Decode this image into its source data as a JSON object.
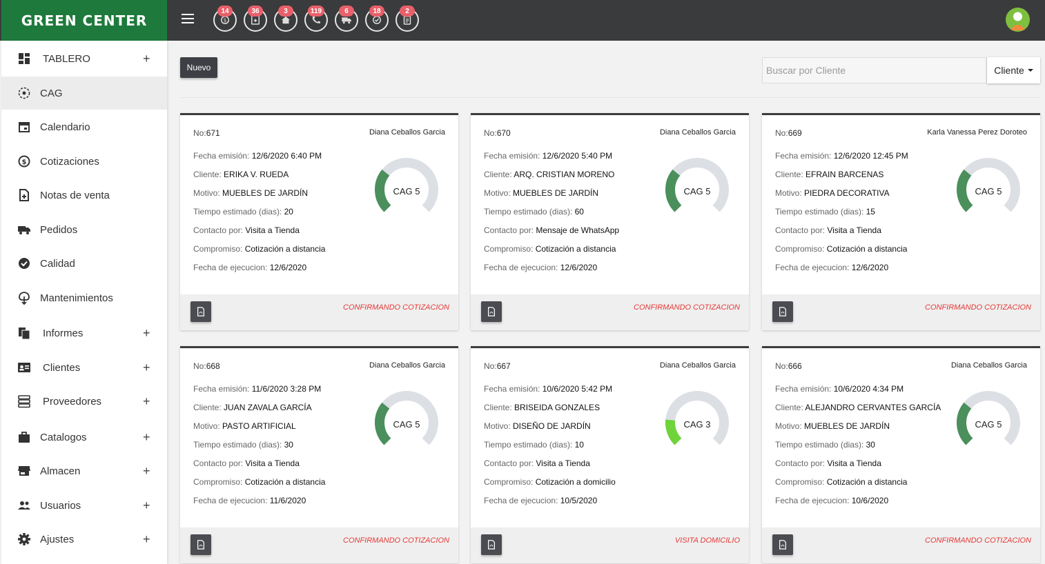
{
  "brand": "GREEN CENTER",
  "nav_icons": [
    {
      "icon": "money-icon",
      "badge": "14"
    },
    {
      "icon": "note-add-icon",
      "badge": "36"
    },
    {
      "icon": "home-icon",
      "badge": "3"
    },
    {
      "icon": "phone-icon",
      "badge": "119"
    },
    {
      "icon": "truck-icon",
      "badge": "6"
    },
    {
      "icon": "check-circle-icon",
      "badge": "18"
    },
    {
      "icon": "clipboard-icon",
      "badge": "2"
    }
  ],
  "sidebar": {
    "items": [
      {
        "label": "TABLERO",
        "icon": "dashboard-icon",
        "expandable": "+"
      },
      {
        "label": "CAG",
        "icon": "target-icon",
        "expandable": ""
      },
      {
        "label": "Calendario",
        "icon": "calendar-icon",
        "expandable": ""
      },
      {
        "label": "Cotizaciones",
        "icon": "dollar-circle-icon",
        "expandable": ""
      },
      {
        "label": "Notas de venta",
        "icon": "note-add-icon",
        "expandable": ""
      },
      {
        "label": "Pedidos",
        "icon": "truck-icon",
        "expandable": ""
      },
      {
        "label": "Calidad",
        "icon": "check-circle-icon",
        "expandable": ""
      },
      {
        "label": "Mantenimientos",
        "icon": "tree-icon",
        "expandable": ""
      },
      {
        "label": "Informes",
        "icon": "documents-icon",
        "expandable": "+"
      },
      {
        "label": "Clientes",
        "icon": "contact-card-icon",
        "expandable": "+"
      },
      {
        "label": "Proveedores",
        "icon": "list-icon",
        "expandable": "+"
      },
      {
        "label": "Catalogos",
        "icon": "briefcase-icon",
        "expandable": "+"
      },
      {
        "label": "Almacen",
        "icon": "store-icon",
        "expandable": "+"
      },
      {
        "label": "Usuarios",
        "icon": "users-icon",
        "expandable": "+"
      },
      {
        "label": "Ajustes",
        "icon": "gear-icon",
        "expandable": "+"
      }
    ],
    "active_index": 1
  },
  "toolbar": {
    "new_label": "Nuevo",
    "search_placeholder": "Buscar por Cliente",
    "filter_label": "Cliente"
  },
  "field_labels": {
    "no": "No:",
    "fecha_emision": "Fecha emisión: ",
    "cliente": "Cliente: ",
    "motivo": "Motivo: ",
    "tiempo": "Tiempo estimado (dias): ",
    "contacto": "Contacto por: ",
    "compromiso": "Compromiso: ",
    "fecha_ejecucion": "Fecha de ejecucion: "
  },
  "colors": {
    "gauge_dark": "#4a8f5c",
    "gauge_light": "#6fd33a",
    "gauge_track": "#dcdfe4",
    "status": "#e53935"
  },
  "cards": [
    {
      "no": "671",
      "user": "Diana Ceballos Garcia",
      "fecha_emision": "12/6/2020 6:40 PM",
      "cliente": "ERIKA V. RUEDA",
      "motivo": "MUEBLES DE JARDÍN",
      "tiempo": "20",
      "contacto": "Visita a Tienda",
      "compromiso": "Cotización a distancia",
      "fecha_ejecucion": "12/6/2020",
      "cag_label": "CAG 5",
      "cag_level": 5,
      "status": "CONFIRMANDO COTIZACION"
    },
    {
      "no": "670",
      "user": "Diana Ceballos Garcia",
      "fecha_emision": "12/6/2020 5:40 PM",
      "cliente": "ARQ. CRISTIAN MORENO",
      "motivo": "MUEBLES DE JARDÍN",
      "tiempo": "60",
      "contacto": "Mensaje de WhatsApp",
      "compromiso": "Cotización a distancia",
      "fecha_ejecucion": "12/6/2020",
      "cag_label": "CAG 5",
      "cag_level": 5,
      "status": "CONFIRMANDO COTIZACION"
    },
    {
      "no": "669",
      "user": "Karla Vanessa Perez Doroteo",
      "fecha_emision": "12/6/2020 12:45 PM",
      "cliente": "EFRAIN BARCENAS",
      "motivo": "PIEDRA DECORATIVA",
      "tiempo": "15",
      "contacto": "Visita a Tienda",
      "compromiso": "Cotización a distancia",
      "fecha_ejecucion": "12/6/2020",
      "cag_label": "CAG 5",
      "cag_level": 5,
      "status": "CONFIRMANDO COTIZACION"
    },
    {
      "no": "668",
      "user": "Diana Ceballos Garcia",
      "fecha_emision": "11/6/2020 3:28 PM",
      "cliente": "JUAN ZAVALA GARCÍA",
      "motivo": "PASTO ARTIFICIAL",
      "tiempo": "30",
      "contacto": "Visita a Tienda",
      "compromiso": "Cotización a distancia",
      "fecha_ejecucion": "11/6/2020",
      "cag_label": "CAG 5",
      "cag_level": 5,
      "status": "CONFIRMANDO COTIZACION"
    },
    {
      "no": "667",
      "user": "Diana Ceballos Garcia",
      "fecha_emision": "10/6/2020 5:42 PM",
      "cliente": "BRISEIDA GONZALES",
      "motivo": "DISEÑO DE JARDÍN",
      "tiempo": "10",
      "contacto": "Visita a Tienda",
      "compromiso": "Cotización a domicilio",
      "fecha_ejecucion": "10/5/2020",
      "cag_label": "CAG 3",
      "cag_level": 3,
      "status": "VISITA DOMICILIO"
    },
    {
      "no": "666",
      "user": "Diana Ceballos Garcia",
      "fecha_emision": "10/6/2020 4:34 PM",
      "cliente": "ALEJANDRO CERVANTES GARCÍA",
      "motivo": "MUEBLES DE JARDÍN",
      "tiempo": "30",
      "contacto": "Visita a Tienda",
      "compromiso": "Cotización a distancia",
      "fecha_ejecucion": "10/6/2020",
      "cag_label": "CAG 5",
      "cag_level": 5,
      "status": "CONFIRMANDO COTIZACION"
    }
  ]
}
